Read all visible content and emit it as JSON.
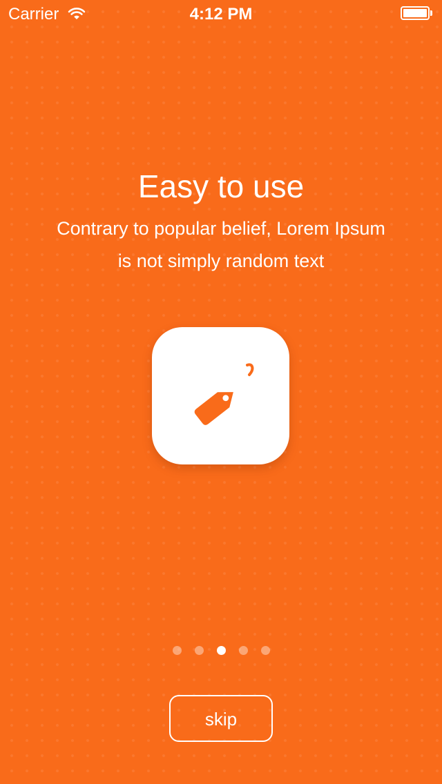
{
  "status_bar": {
    "carrier": "Carrier",
    "time": "4:12 PM",
    "wifi_icon": "wifi-icon",
    "battery_icon": "battery-icon",
    "battery_level": 1.0
  },
  "onboarding": {
    "title": "Easy to use",
    "subtitle": "Contrary to popular belief, Lorem Ipsum is not simply random text",
    "icon": "price-tag-icon"
  },
  "pagination": {
    "total_pages": 5,
    "current_page": 3
  },
  "actions": {
    "skip_label": "skip"
  },
  "colors": {
    "background": "#f96b1a",
    "accent": "#f96b1a",
    "foreground": "#ffffff"
  }
}
